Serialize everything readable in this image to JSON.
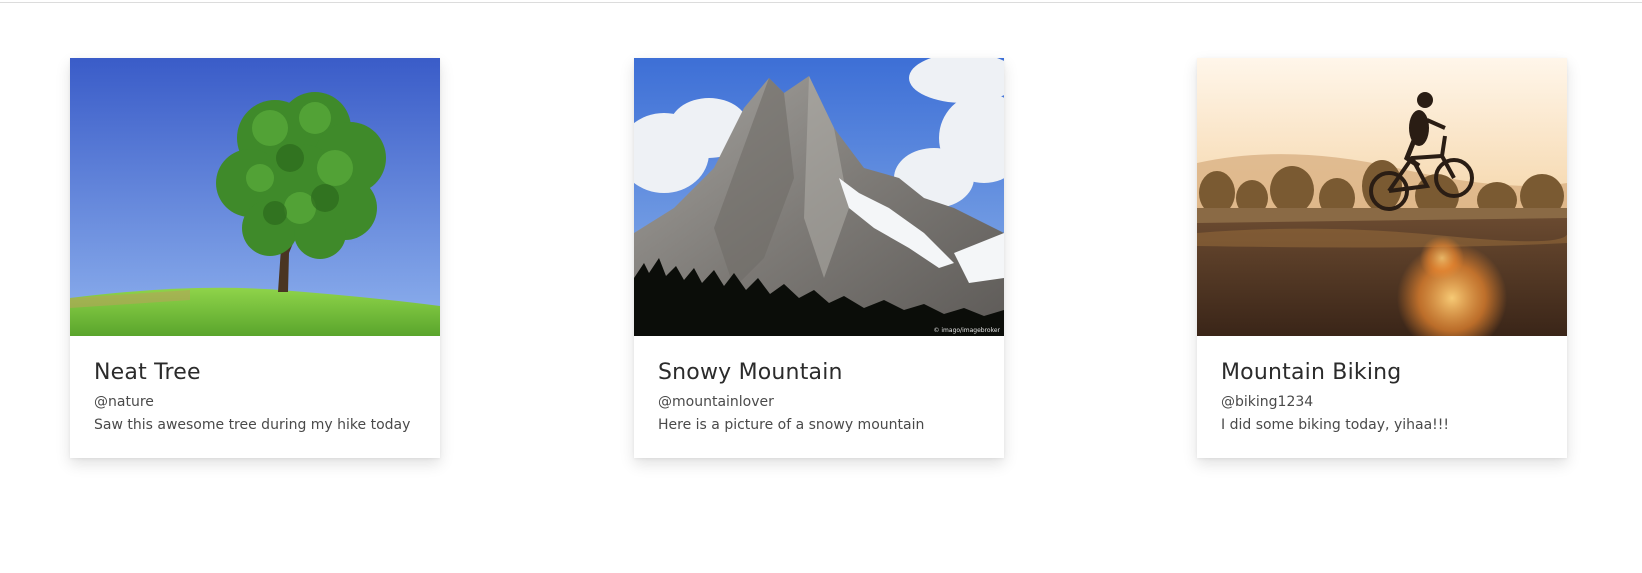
{
  "posts": [
    {
      "title": "Neat Tree",
      "handle": "@nature",
      "caption": "Saw this awesome tree during my hike today",
      "image": "tree-photo"
    },
    {
      "title": "Snowy Mountain",
      "handle": "@mountainlover",
      "caption": "Here is a picture of a snowy mountain",
      "image": "mountain-photo",
      "image_watermark": "© imago/imagebroker"
    },
    {
      "title": "Mountain Biking",
      "handle": "@biking1234",
      "caption": "I did some biking today, yihaa!!!",
      "image": "mountain-biking-photo"
    }
  ],
  "colors": {
    "sky_blue": "#5a84d8",
    "grass_green": "#79c23f",
    "tree_green": "#3f8a2a",
    "mountain_gray": "#8a8886",
    "sunset_orange": "#f2a04a"
  }
}
